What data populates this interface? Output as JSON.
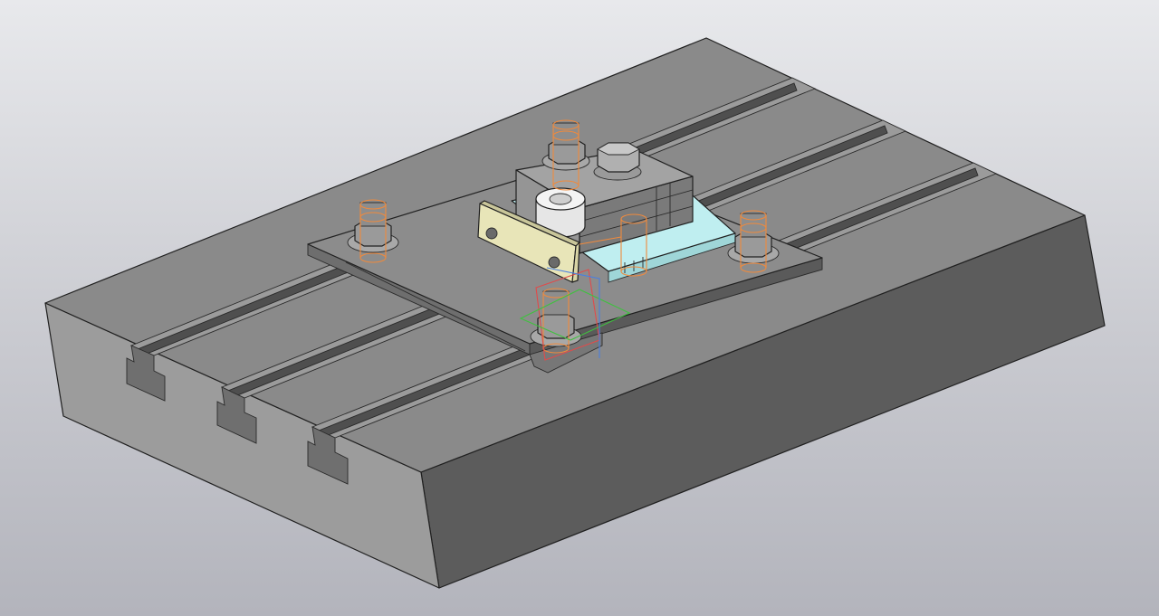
{
  "scene": {
    "view": "isometric",
    "background_top": "#e8e9ec",
    "background_bottom": "#b3b4bc",
    "colors": {
      "table_top": "#8a8a8a",
      "table_front": "#9a9a9a",
      "table_side": "#5c5c5c",
      "base_plate": "#8c8c8c",
      "clamp_block": "#8f8f8f",
      "bushing": "#ececec",
      "plate_yellow": "#e8e5b8",
      "plate_cyan": "#bfeef0",
      "wire_orange": "#f08a3c",
      "wire_red": "#e04b4b",
      "wire_green": "#3fc13f",
      "wire_blue": "#4b7fe0"
    },
    "objects": [
      "t-slot-table",
      "base-plate",
      "clamp-block",
      "hex-bolt",
      "drill-bushing",
      "yellow-strap-plate",
      "cyan-support-plate",
      "stud-nut-left",
      "stud-nut-top",
      "stud-nut-right",
      "stud-nut-front",
      "coordinate-triad"
    ]
  }
}
